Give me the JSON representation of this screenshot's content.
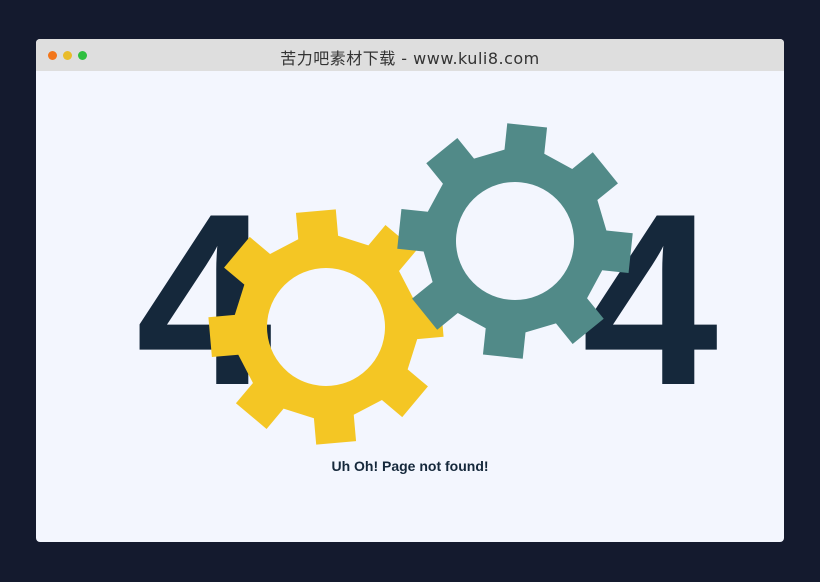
{
  "window": {
    "title": "苦力吧素材下载 - www.kuli8.com",
    "controls": [
      "close",
      "minimize",
      "maximize"
    ]
  },
  "error": {
    "left_digit": "4",
    "right_digit": "4",
    "message": "Uh Oh! Page not found!"
  },
  "colors": {
    "digit": "#15283b",
    "gear_left": "#f4c624",
    "gear_right": "#518a88",
    "background": "#f3f6fe"
  },
  "icons": [
    "yellow-gear-icon",
    "teal-gear-icon"
  ]
}
